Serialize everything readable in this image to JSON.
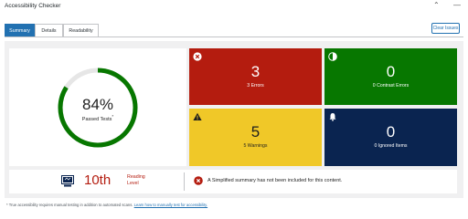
{
  "panel": {
    "title": "Accessibility Checker",
    "collapse_icon": "chevron-up-icon",
    "menu_icon": "minus-icon"
  },
  "tabs": [
    {
      "label": "Summary",
      "active": true
    },
    {
      "label": "Details",
      "active": false
    },
    {
      "label": "Readability",
      "active": false
    }
  ],
  "clear_issues_label": "Clear Issues",
  "summary": {
    "passed_percent": "84%",
    "passed_fraction": 0.84,
    "passed_label": "Passed Tests",
    "passed_footnote_marker": "*",
    "tiles": {
      "errors": {
        "count": "3",
        "label": "3 Errors",
        "icon": "x-circle-icon",
        "color": "#b41c0f"
      },
      "contrast": {
        "count": "0",
        "label": "0 Contrast Errors",
        "icon": "contrast-icon",
        "color": "#077700"
      },
      "warnings": {
        "count": "5",
        "label": "5 Warnings",
        "icon": "warning-icon",
        "color": "#f0c828"
      },
      "ignored": {
        "count": "0",
        "label": "0 Ignored Items",
        "icon": "bell-icon",
        "color": "#0a2450"
      }
    },
    "ring_color": "#077700"
  },
  "readability": {
    "grade": "10th",
    "level_label": "Reading Level",
    "icon": "readability-icon",
    "simplified_message": "A Simplified summary has not been included for this content.",
    "simplified_icon": "error-circle-icon"
  },
  "footnote": {
    "text": "* True accessibility requires manual testing in addition to automated scans.",
    "link": "Learn how to manually test for accessibility."
  }
}
